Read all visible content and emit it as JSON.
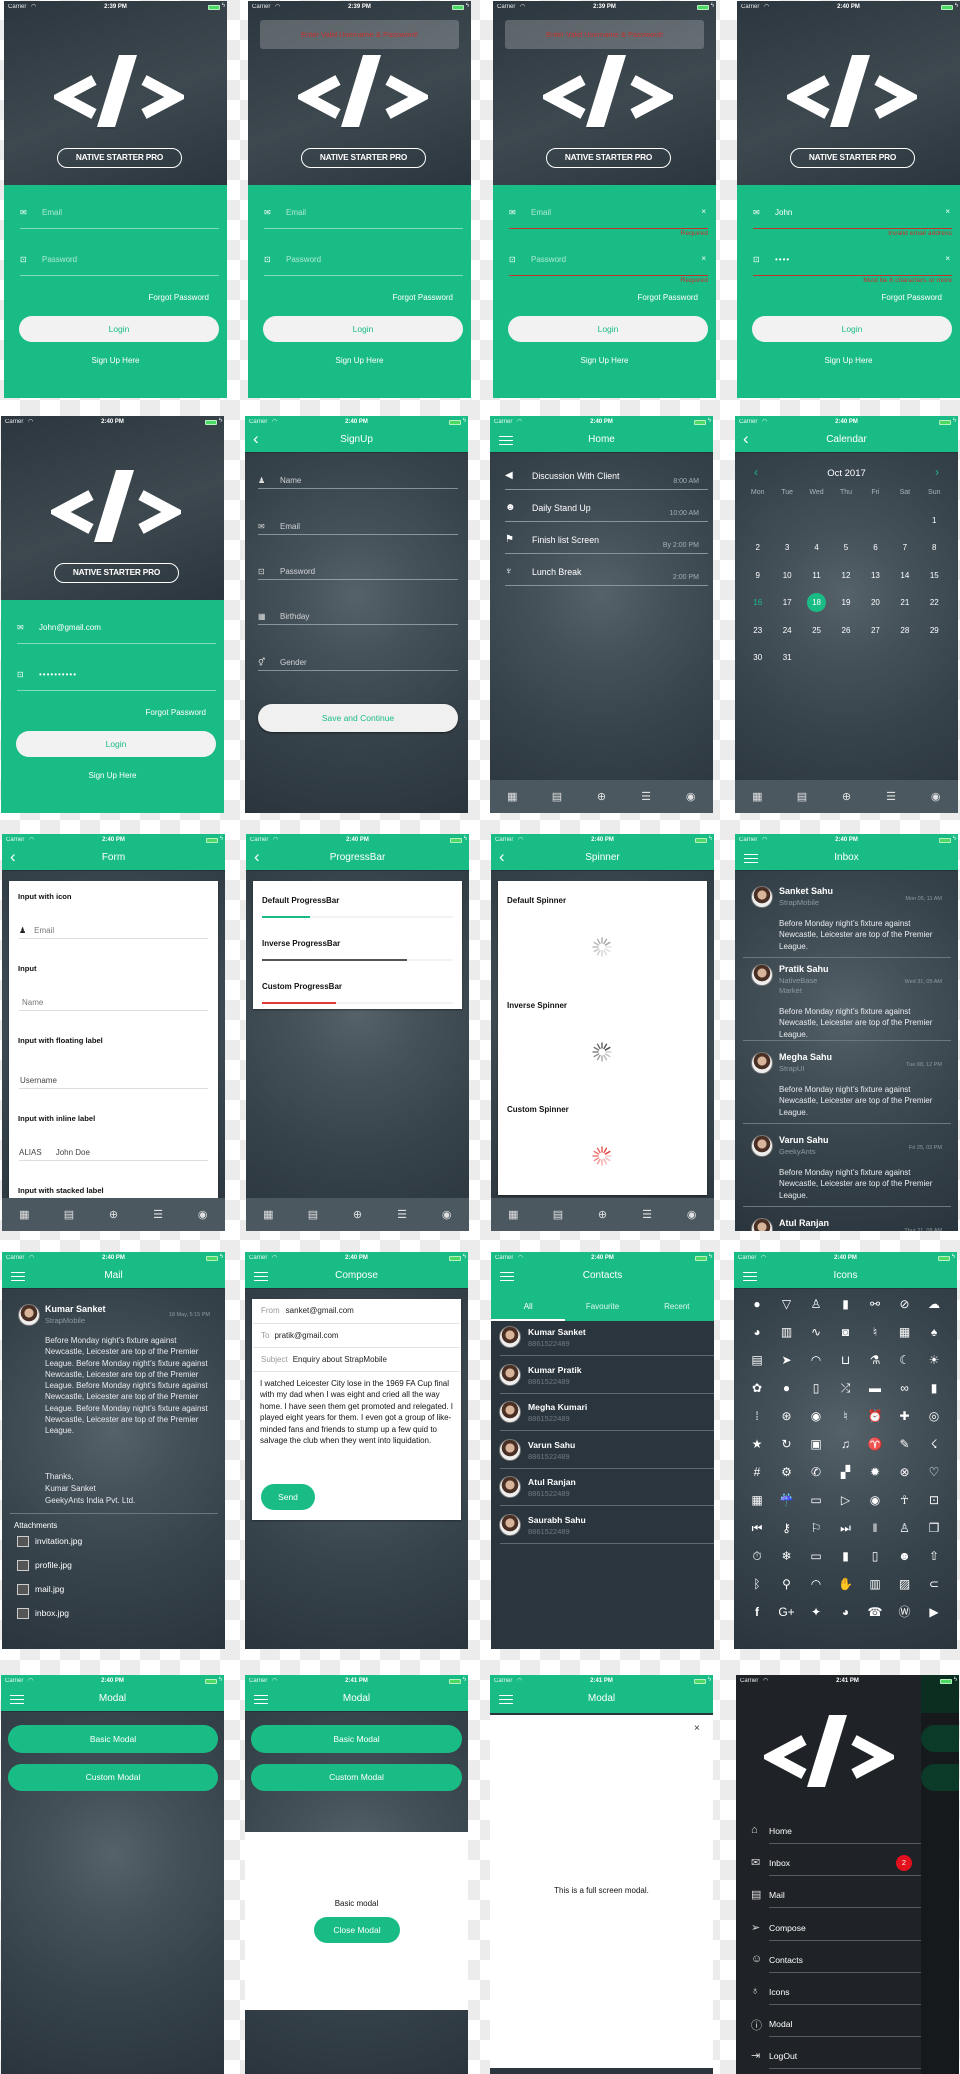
{
  "status": {
    "carrier": "Carrier",
    "wifi_icon": "wifi-icon",
    "battery_icon": "battery-charging-icon"
  },
  "colors": {
    "primary": "#1abc86",
    "dark": "#2d3740",
    "error": "#c5312f",
    "badge": "#e3101e",
    "tabbar": "#4b5860"
  },
  "brand": {
    "logo": "</>",
    "name": "NATIVE STARTER PRO"
  },
  "login": {
    "email_placeholder": "Email",
    "password_placeholder": "Password",
    "forgot": "Forgot Password",
    "login": "Login",
    "signup": "Sign Up Here"
  },
  "login_screens": [
    {
      "time": "2:39 PM",
      "toast": "",
      "email": "",
      "password": "",
      "email_error": "",
      "password_error": "",
      "show_clear": false
    },
    {
      "time": "2:39 PM",
      "toast": "Enter Valid Username & Password!",
      "email": "",
      "password": "",
      "email_error": "",
      "password_error": "",
      "show_clear": false
    },
    {
      "time": "2:39 PM",
      "toast": "Enter Valid Username & Password!",
      "email": "",
      "password": "",
      "email_error": "Required",
      "password_error": "Required",
      "show_clear": true
    },
    {
      "time": "2:40 PM",
      "toast": "",
      "email": "John",
      "password": "••••",
      "email_error": "Invalid email address",
      "password_error": "Must be 8 characters or more",
      "show_clear": true
    },
    {
      "time": "2:40 PM",
      "toast": "",
      "email": "John@gmail.com",
      "password": "••••••••••",
      "email_error": "",
      "password_error": "",
      "show_clear": false
    }
  ],
  "tabbar": {
    "icons": [
      {
        "name": "calendar-icon",
        "glyph": "▦"
      },
      {
        "name": "list-icon",
        "glyph": "▤"
      },
      {
        "name": "add-circle-icon",
        "glyph": "⊕"
      },
      {
        "name": "sliders-icon",
        "glyph": "☰"
      },
      {
        "name": "refresh-icon",
        "glyph": "◉"
      }
    ]
  },
  "signup": {
    "time": "2:40 PM",
    "title": "SignUp",
    "fields": [
      "Name",
      "Email",
      "Password",
      "Birthday",
      "Gender"
    ],
    "submit": "Save and Continue"
  },
  "home": {
    "time": "2:40 PM",
    "title": "Home",
    "items": [
      {
        "title": "Discussion With Client",
        "time": "8:00 AM",
        "icon": "megaphone-icon"
      },
      {
        "title": "Daily Stand Up",
        "time": "10:00 AM",
        "icon": "people-icon"
      },
      {
        "title": "Finish list Screen",
        "time": "By 2:00 PM",
        "icon": "flag-icon"
      },
      {
        "title": "Lunch Break",
        "time": "2:00 PM",
        "icon": "restaurant-icon"
      }
    ]
  },
  "calendar": {
    "time": "2:40 PM",
    "title": "Calendar",
    "month_label": "Oct 2017",
    "weekdays": [
      "Mon",
      "Tue",
      "Wed",
      "Thu",
      "Fri",
      "Sat",
      "Sun"
    ],
    "days": [
      "1",
      "2",
      "3",
      "4",
      "5",
      "6",
      "7",
      "8",
      "9",
      "10",
      "11",
      "12",
      "13",
      "14",
      "15",
      "16",
      "17",
      "18",
      "19",
      "20",
      "21",
      "22",
      "23",
      "24",
      "25",
      "26",
      "27",
      "28",
      "29",
      "30",
      "31"
    ],
    "selected": "18",
    "today": "16"
  },
  "form": {
    "time": "2:40 PM",
    "title": "Form",
    "sections": [
      {
        "label": "Input with icon",
        "placeholder": "Email"
      },
      {
        "label": "Input",
        "placeholder": "Name"
      },
      {
        "label": "Input with floating label",
        "placeholder": "Username"
      },
      {
        "label": "Input with inline label",
        "inline_label": "ALIAS",
        "value": "John Doe"
      },
      {
        "label": "Input with stacked label"
      }
    ]
  },
  "progressbar": {
    "time": "2:40 PM",
    "title": "ProgressBar",
    "bars": [
      {
        "label": "Default ProgressBar",
        "progress": 0.25,
        "color": "#1abc86"
      },
      {
        "label": "Inverse ProgressBar",
        "progress": 0.76,
        "color": "#555555"
      },
      {
        "label": "Custom ProgressBar",
        "progress": 0.39,
        "color": "#e53935"
      }
    ]
  },
  "spinner": {
    "time": "2:40 PM",
    "title": "Spinner",
    "items": [
      {
        "label": "Default Spinner",
        "color": "#9e9e9e"
      },
      {
        "label": "Inverse Spinner",
        "color": "#444444"
      },
      {
        "label": "Custom Spinner",
        "color": "#e53935"
      }
    ]
  },
  "inbox": {
    "time": "2:40 PM",
    "title": "Inbox",
    "items": [
      {
        "name": "Sanket Sahu",
        "org": "StrapMobile",
        "time": "Mon 05, 11 AM",
        "message": "Before Monday night’s fixture against Newcastle, Leicester are top of the Premier League."
      },
      {
        "name": "Pratik Sahu",
        "org": "NativeBase Market",
        "time": "Wed 31, 05 AM",
        "message": "Before Monday night’s fixture against Newcastle, Leicester are top of the Premier League."
      },
      {
        "name": "Megha Sahu",
        "org": "StrapUI",
        "time": "Tue 08, 12 PM",
        "message": "Before Monday night’s fixture against Newcastle, Leicester are top of the Premier League."
      },
      {
        "name": "Varun Sahu",
        "org": "GeekyAnts",
        "time": "Fri 25, 03 PM",
        "message": "Before Monday night’s fixture against Newcastle, Leicester are top of the Premier League."
      },
      {
        "name": "Atul Ranjan",
        "time": "Thur 21, 08 AM"
      }
    ]
  },
  "mail": {
    "time": "2:40 PM",
    "title": "Mail",
    "sender": "Kumar Sanket",
    "org": "StrapMobile",
    "date": "18 May, 5:15 PM",
    "body": "Before Monday night’s fixture against Newcastle, Leicester are top of the Premier League. Before Monday night’s fixture against Newcastle, Leicester are top of the Premier League. Before Monday night’s fixture against Newcastle, Leicester are top of the Premier League. Before Monday night’s fixture against Newcastle, Leicester are top of the Premier League.",
    "signature": [
      "Thanks,",
      "Kumar Sanket",
      "GeekyAnts India Pvt. Ltd."
    ],
    "attachments_label": "Attachments",
    "attachments": [
      "invitation.jpg",
      "profile.jpg",
      "mail.jpg",
      "inbox.jpg"
    ]
  },
  "compose": {
    "time": "2:40 PM",
    "title": "Compose",
    "from_label": "From",
    "from": "sanket@gmail.com",
    "to_label": "To",
    "to": "pratik@gmail.com",
    "subject_label": "Subject",
    "subject": "Enquiry about StrapMobile",
    "body": "I watched Leicester City lose in the 1969 FA Cup final with my dad when I was eight and cried all the way home. I have seen them get promoted and relegated. I played eight years for them. I even got a group of like-minded fans and friends to stump up a few quid to salvage the club when they went into liquidation.",
    "send": "Send"
  },
  "contacts": {
    "time": "2:40 PM",
    "title": "Contacts",
    "tabs": [
      "All",
      "Favourite",
      "Recent"
    ],
    "active_tab": "All",
    "items": [
      {
        "name": "Kumar Sanket",
        "phone": "8861522489"
      },
      {
        "name": "Kumar Pratik",
        "phone": "8861522489"
      },
      {
        "name": "Megha Kumari",
        "phone": "8861522489"
      },
      {
        "name": "Varun Sahu",
        "phone": "8861522489"
      },
      {
        "name": "Atul Ranjan",
        "phone": "8861522489"
      },
      {
        "name": "Saurabh Sahu",
        "phone": "8861522489"
      }
    ]
  },
  "icons": {
    "time": "2:40 PM",
    "title": "Icons",
    "items": [
      "apple",
      "pizza",
      "person",
      "beer",
      "bicycle",
      "compass",
      "cloud",
      "pie-chart",
      "book",
      "pulse",
      "camera",
      "mic-off",
      "film",
      "flame",
      "paper",
      "paper-plane",
      "speedometer",
      "cart",
      "flask",
      "cloudy-night",
      "partly-sunny",
      "paw",
      "nutrition",
      "pint",
      "shuffle",
      "game-controller",
      "glasses",
      "microphone",
      "apps",
      "color-filter",
      "eye",
      "mic-off-outline",
      "alarm",
      "medkit",
      "disc",
      "star-half",
      "refresh",
      "train",
      "musical-note",
      "wine",
      "carrot",
      "thunderstorm",
      "hashtag",
      "settings",
      "chatbubbles",
      "chatboxes",
      "sunburst",
      "baseball",
      "bulb",
      "calculator",
      "rainy",
      "videocam",
      "play",
      "radio-button",
      "body",
      "lock",
      "skip-backward",
      "key",
      "flag",
      "skip-forward",
      "barcode",
      "tux",
      "copy",
      "stopwatch",
      "snow",
      "archive",
      "bookmark",
      "clipboard",
      "happy",
      "share",
      "bluetooth",
      "search",
      "wifi",
      "hand",
      "trash",
      "images",
      "attach",
      "facebook",
      "google-plus",
      "twitter",
      "github",
      "whatsapp",
      "wordpress",
      "youtube"
    ]
  },
  "modal": {
    "title": "Modal",
    "basic_button": "Basic Modal",
    "custom_button": "Custom Modal",
    "basic_text": "Basic modal",
    "close_button": "Close Modal",
    "fullscreen_text": "This is a full screen modal.",
    "times": [
      "2:40 PM",
      "2:41 PM",
      "2:41 PM"
    ]
  },
  "drawer": {
    "time": "2:41 PM",
    "items": [
      {
        "label": "Home",
        "icon": "home-icon",
        "glyph": "⌂"
      },
      {
        "label": "Inbox",
        "icon": "mail-open-icon",
        "glyph": "✉",
        "badge": "2"
      },
      {
        "label": "Mail",
        "icon": "paper-icon",
        "glyph": "▤"
      },
      {
        "label": "Compose",
        "icon": "paper-plane-icon",
        "glyph": "➢"
      },
      {
        "label": "Contacts",
        "icon": "people-icon",
        "glyph": "☺"
      },
      {
        "label": "Icons",
        "icon": "planet-icon",
        "glyph": "♁"
      },
      {
        "label": "Modal",
        "icon": "alert-circle-icon",
        "glyph": "ⓘ"
      },
      {
        "label": "LogOut",
        "icon": "log-out-icon",
        "glyph": "⇥"
      }
    ]
  }
}
